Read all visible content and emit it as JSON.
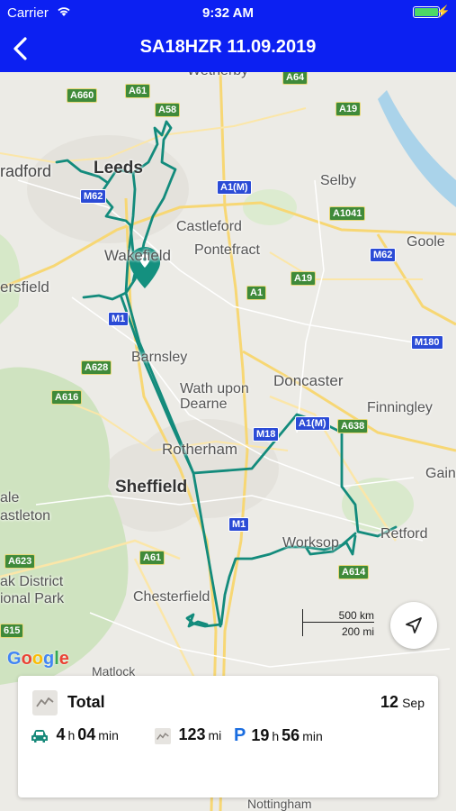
{
  "status_bar": {
    "carrier": "Carrier",
    "time": "9:32 AM",
    "charge_glyph": "⚡"
  },
  "nav": {
    "back_icon": "chevron-left-icon",
    "title": "SA18HZR 11.09.2019"
  },
  "map": {
    "places": {
      "leeds": "Leeds",
      "bradford": "radford",
      "selby": "Selby",
      "castleford": "Castleford",
      "pontefract": "Pontefract",
      "goole": "Goole",
      "wakefield": "Wakefield",
      "huddersfield": "ersfield",
      "barnsley": "Barnsley",
      "doncaster": "Doncaster",
      "wath": "Wath upon\nDearne",
      "finningley": "Finningley",
      "rotherham": "Rotherham",
      "sheffield": "Sheffield",
      "gainsborough": "Gain",
      "dale": "ale",
      "castleton": "astleton",
      "worksop": "Worksop",
      "retford": "Retford",
      "peak_district": "ak District\nional Park",
      "chesterfield": "Chesterfield",
      "matlock": "Matlock",
      "nottingham": "Nottingham",
      "wetherby": "Wetherby"
    },
    "roads": [
      "A660",
      "A61",
      "A58",
      "A64",
      "A19",
      "M62",
      "A1(M)",
      "A1041",
      "A1",
      "A19",
      "M62",
      "M180",
      "A628",
      "M1",
      "A616",
      "M18",
      "A1(M)",
      "A638",
      "M1",
      "A61",
      "A623",
      "A614",
      "615"
    ],
    "scale": {
      "km": "500 km",
      "mi": "200 mi"
    },
    "google": "Google",
    "locate_icon": "navigation-arrow-icon",
    "pin_icon": "location-pin-icon"
  },
  "summary": {
    "title": "Total",
    "date_day": "12",
    "date_month": "Sep",
    "drive_hours": "4",
    "drive_minutes": "04",
    "distance": "123",
    "distance_unit": "mi",
    "park_hours": "19",
    "park_minutes": "56",
    "unit_h": "h",
    "unit_min": "min",
    "parking_label": "P"
  },
  "colors": {
    "brand_blue": "#0c20f2",
    "route": "#138b7c",
    "pin": "#14907f"
  }
}
